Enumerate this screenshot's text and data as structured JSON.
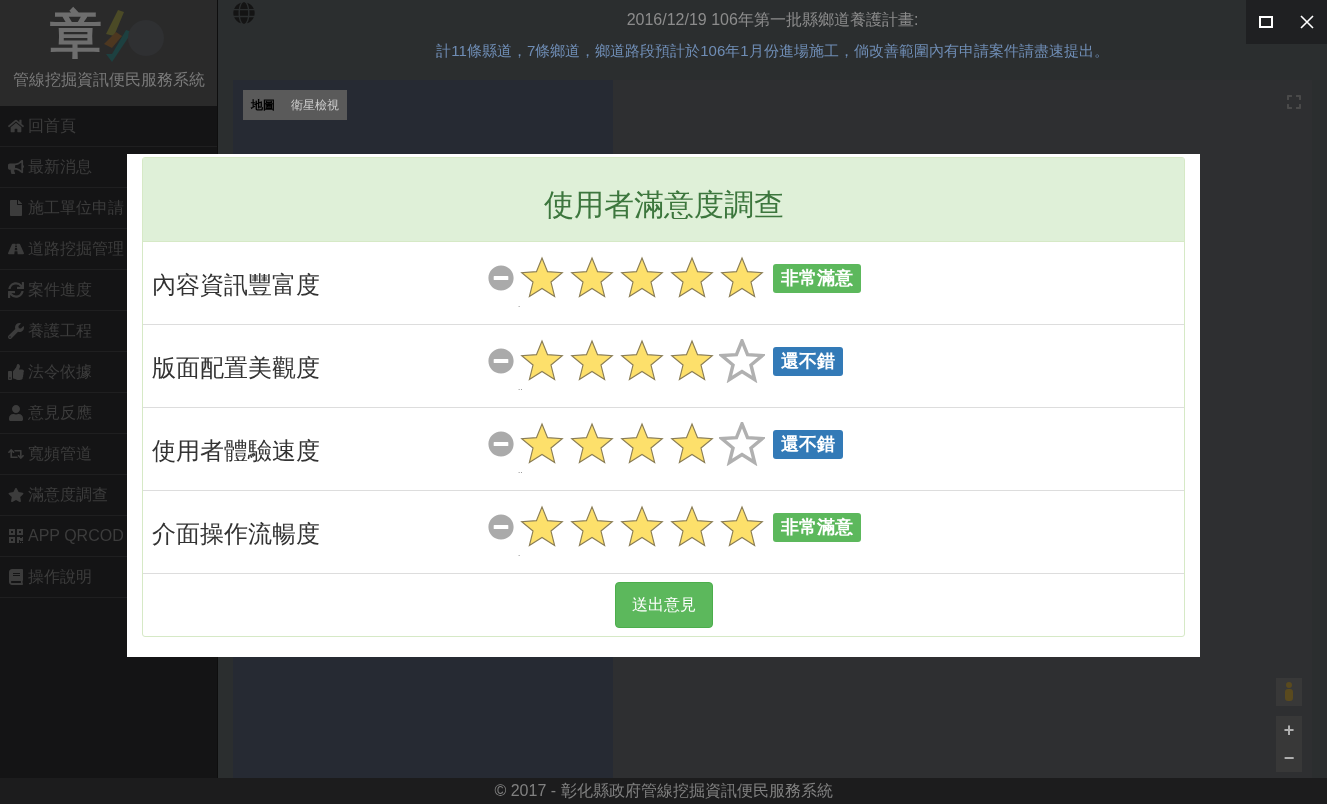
{
  "logo": {
    "mark": "章",
    "title": "管線挖掘資訊便民服務系統"
  },
  "sidebar": {
    "items": [
      {
        "label": "回首頁"
      },
      {
        "label": "最新消息"
      },
      {
        "label": "施工單位申請"
      },
      {
        "label": "道路挖掘管理"
      },
      {
        "label": "案件進度"
      },
      {
        "label": "養護工程"
      },
      {
        "label": "法令依據"
      },
      {
        "label": "意見反應"
      },
      {
        "label": "寬頻管道"
      },
      {
        "label": "滿意度調查"
      },
      {
        "label": "APP QRCOD"
      },
      {
        "label": "操作說明"
      }
    ]
  },
  "announcement": {
    "title": "2016/12/19 106年第一批縣鄉道養護計畫:",
    "body": "計11條縣道，7條鄉道，鄉道路段預計於106年1月份進場施工，倘改善範圍內有申請案件請盡速提出。"
  },
  "map": {
    "types": [
      {
        "label": "地圖",
        "selected": true
      },
      {
        "label": "衛星檢視",
        "selected": false
      }
    ],
    "zoom_in": "+",
    "zoom_out": "−"
  },
  "footer": "© 2017 - 彰化縣政府管線挖掘資訊便民服務系統",
  "survey": {
    "title": "使用者滿意度調查",
    "rows": [
      {
        "label": "內容資訊豐富度",
        "stars": 5,
        "badge": "非常滿意",
        "color": "#5cb85c",
        "caption": "."
      },
      {
        "label": "版面配置美觀度",
        "stars": 4,
        "badge": "還不錯",
        "color": "#337ab7",
        "caption": ".."
      },
      {
        "label": "使用者體驗速度",
        "stars": 4,
        "badge": "還不錯",
        "color": "#337ab7",
        "caption": ".."
      },
      {
        "label": "介面操作流暢度",
        "stars": 5,
        "badge": "非常滿意",
        "color": "#5cb85c",
        "caption": "."
      }
    ],
    "submit": "送出意見"
  }
}
